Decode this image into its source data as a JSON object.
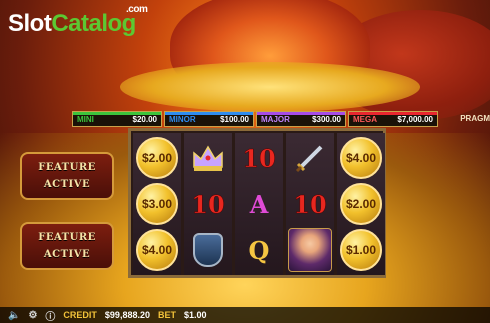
{
  "logo": {
    "part1": "Slot",
    "part2": "Catalog",
    "suffix": ".com"
  },
  "brand_text": "PRAGM",
  "jackpots": [
    {
      "name": "MINI",
      "value": "$20.00",
      "color": "#3cc43c"
    },
    {
      "name": "MINOR",
      "value": "$100.00",
      "color": "#2f8cf0"
    },
    {
      "name": "MAJOR",
      "value": "$300.00",
      "color": "#a64ce8"
    },
    {
      "name": "MEGA",
      "value": "$7,000.00",
      "color": "#e8262f"
    }
  ],
  "reels": [
    [
      {
        "type": "coin",
        "label": "$2.00"
      },
      {
        "type": "coin",
        "label": "$3.00"
      },
      {
        "type": "coin",
        "label": "$4.00"
      }
    ],
    [
      {
        "type": "icon",
        "icon": "crown-icon"
      },
      {
        "type": "ten",
        "label": "10"
      },
      {
        "type": "icon",
        "icon": "shield-icon"
      }
    ],
    [
      {
        "type": "ten",
        "label": "10"
      },
      {
        "type": "letter",
        "label": "A"
      },
      {
        "type": "letter",
        "label": "Q"
      }
    ],
    [
      {
        "type": "icon",
        "icon": "sword-icon"
      },
      {
        "type": "ten",
        "label": "10"
      },
      {
        "type": "icon",
        "icon": "princess-icon"
      }
    ],
    [
      {
        "type": "coin",
        "label": "$4.00"
      },
      {
        "type": "coin",
        "label": "$2.00"
      },
      {
        "type": "coin",
        "label": "$1.00"
      }
    ]
  ],
  "feature_panels": [
    {
      "line1": "FEATURE",
      "line2": "ACTIVE"
    },
    {
      "line1": "FEATURE",
      "line2": "ACTIVE"
    }
  ],
  "bottom_bar": {
    "credit_label": "CREDIT",
    "credit_value": "$99,888.20",
    "bet_label": "BET",
    "bet_value": "$1.00"
  }
}
